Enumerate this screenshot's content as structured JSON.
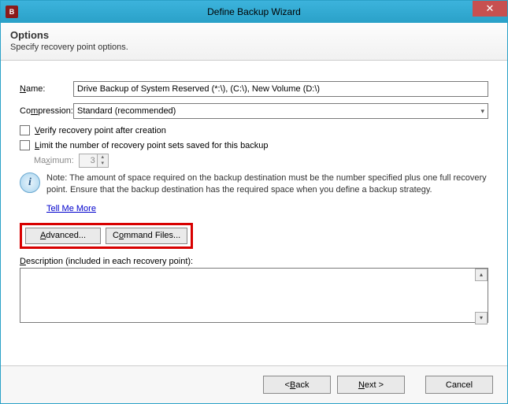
{
  "window": {
    "title": "Define Backup Wizard"
  },
  "header": {
    "title": "Options",
    "subtitle": "Specify recovery point options."
  },
  "form": {
    "name_label_pre": "N",
    "name_label_post": "ame:",
    "name_value": "Drive Backup of System Reserved (*:\\), (C:\\), New Volume (D:\\)",
    "compression_label_pre": "Co",
    "compression_label_u": "m",
    "compression_label_post": "pression:",
    "compression_value": "Standard (recommended)",
    "verify_pre": "",
    "verify_u": "V",
    "verify_post": "erify recovery point after creation",
    "limit_pre": "",
    "limit_u": "L",
    "limit_post": "imit the number of recovery point sets saved for this backup",
    "max_label_pre": "Ma",
    "max_label_u": "x",
    "max_label_post": "imum:",
    "max_value": "3",
    "note": "Note: The amount of space required on the backup destination must be the number specified plus one full recovery point. Ensure that the backup destination has the required space when you define a backup strategy.",
    "tell_more": "Tell Me More",
    "advanced": "Advanced...",
    "command_files": "Command Files...",
    "desc_label_u": "D",
    "desc_label_post": "escription (included in each recovery point):",
    "desc_value": ""
  },
  "footer": {
    "back_pre": "< ",
    "back_u": "B",
    "back_post": "ack",
    "next_u": "N",
    "next_post": "ext >",
    "cancel": "Cancel"
  }
}
